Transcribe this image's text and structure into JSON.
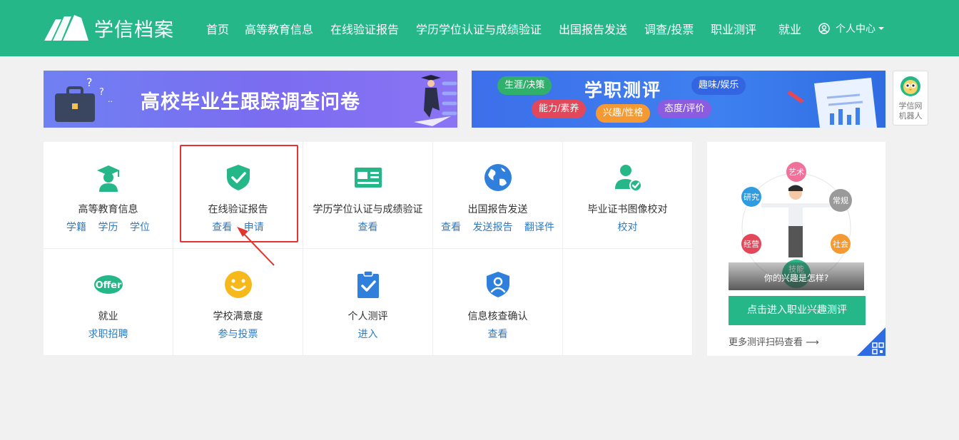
{
  "header": {
    "logo_text": "学信档案",
    "nav": [
      {
        "label": "首页"
      },
      {
        "label": "高等教育信息"
      },
      {
        "label": "在线验证报告"
      },
      {
        "label": "学历学位认证与成绩验证"
      },
      {
        "label": "出国报告发送"
      },
      {
        "label": "调查/投票"
      },
      {
        "label": "职业测评"
      },
      {
        "label": "就业"
      }
    ],
    "user_menu": "个人中心"
  },
  "banners": {
    "left_title": "高校毕业生跟踪调查问卷",
    "right_title": "学职测评",
    "right_tags": [
      "生涯/决策",
      "趣味/娱乐",
      "能力/素养",
      "兴趣/性格",
      "态度/评价"
    ]
  },
  "robot": {
    "line1": "学信网",
    "line2": "机器人"
  },
  "services": [
    {
      "title": "高等教育信息",
      "links": [
        "学籍",
        "学历",
        "学位"
      ]
    },
    {
      "title": "在线验证报告",
      "links": [
        "查看",
        "申请"
      ]
    },
    {
      "title": "学历学位认证与成绩验证",
      "links": [
        "查看"
      ]
    },
    {
      "title": "出国报告发送",
      "links": [
        "查看",
        "发送报告",
        "翻译件"
      ]
    },
    {
      "title": "毕业证书图像校对",
      "links": [
        "校对"
      ]
    },
    {
      "title": "就业",
      "links": [
        "求职招聘"
      ],
      "icon_text": "Offer"
    },
    {
      "title": "学校满意度",
      "links": [
        "参与投票"
      ]
    },
    {
      "title": "个人测评",
      "links": [
        "进入"
      ]
    },
    {
      "title": "信息核查确认",
      "links": [
        "查看"
      ]
    }
  ],
  "promo": {
    "labels": [
      "艺术",
      "研究",
      "常规",
      "经营",
      "社会",
      "技能"
    ],
    "caption": "你的兴趣是怎样?",
    "button": "点击进入职业兴趣测评",
    "more": "更多测评扫码查看 ⟶"
  },
  "colors": {
    "brand": "#25b787",
    "link": "#2d7bc5",
    "highlight": "#e3342f"
  }
}
